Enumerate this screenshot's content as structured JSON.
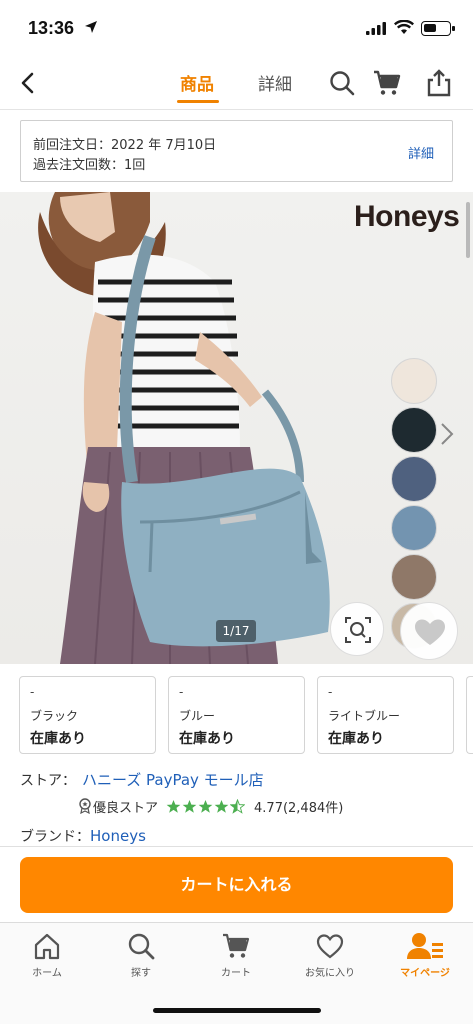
{
  "status": {
    "time": "13:36"
  },
  "nav": {
    "tab_goods": "商品",
    "tab_detail": "詳細"
  },
  "order": {
    "last_date": "前回注文日：2022 年 7月10日",
    "count": "過去注文回数：1回",
    "detail_link": "詳細"
  },
  "hero": {
    "brand_logo": "Honeys",
    "counter": "1/17",
    "swatch_colors": [
      "#efe6dc",
      "#1e2a30",
      "#4f617f",
      "#7394b0",
      "#8f7868",
      "#c8b9a6"
    ]
  },
  "variants": [
    {
      "dash": "-",
      "name": "ブラック",
      "stock": "在庫あり"
    },
    {
      "dash": "-",
      "name": "ブルー",
      "stock": "在庫あり"
    },
    {
      "dash": "-",
      "name": "ライトブルー",
      "stock": "在庫あり"
    }
  ],
  "store": {
    "label": "ストア：",
    "name": "ハニーズ PayPay モール店",
    "badge": "優良ストア",
    "rating_stars": 4.5,
    "rating_text": "4.77(2,484件)"
  },
  "brand": {
    "label": "ブランド：",
    "name": "Honeys"
  },
  "cart_button": "カートに入れる",
  "tabbar": {
    "items": [
      {
        "label": "ホーム",
        "icon": "home-icon"
      },
      {
        "label": "探す",
        "icon": "search-icon"
      },
      {
        "label": "カート",
        "icon": "cart-icon"
      },
      {
        "label": "お気に入り",
        "icon": "heart-icon"
      },
      {
        "label": "マイページ",
        "icon": "user-icon"
      }
    ],
    "active_index": 4
  },
  "colors": {
    "accent": "#f08200",
    "cart_button": "#ff8700",
    "link": "#1f5fb8",
    "star": "#4caf50"
  }
}
